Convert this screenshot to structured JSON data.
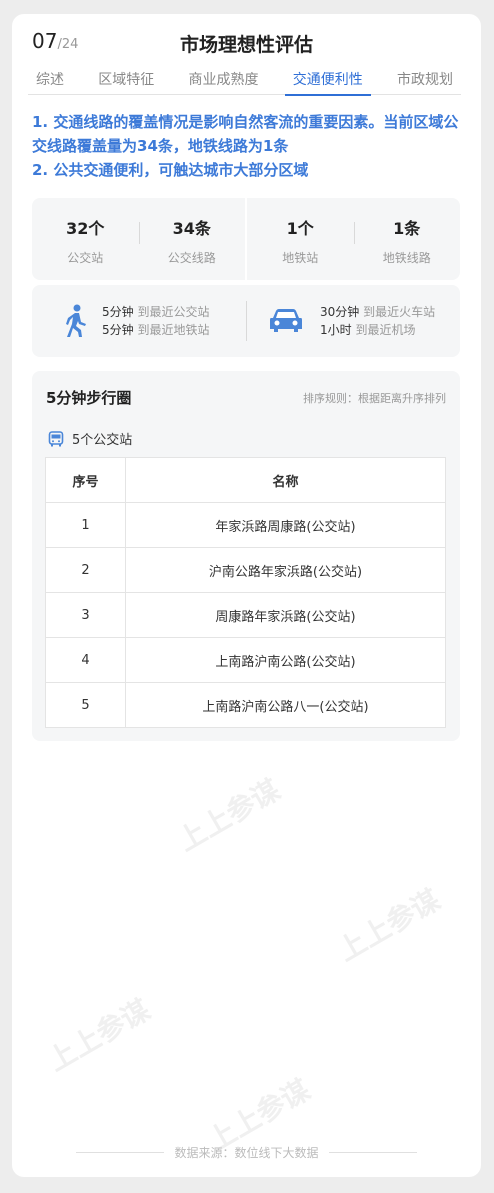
{
  "header": {
    "page_current": "07",
    "page_total": "/24",
    "title": "市场理想性评估"
  },
  "tabs": [
    {
      "label": "综述",
      "active": false
    },
    {
      "label": "区域特征",
      "active": false
    },
    {
      "label": "商业成熟度",
      "active": false
    },
    {
      "label": "交通便利性",
      "active": true
    },
    {
      "label": "市政规划",
      "active": false
    }
  ],
  "summary": {
    "line1": "1. 交通线路的覆盖情况是影响自然客流的重要因素。当前区域公交线路覆盖量为34条，地铁线路为1条",
    "line2": "2. 公共交通便利，可触达城市大部分区域"
  },
  "stats": [
    {
      "value": "32个",
      "label": "公交站"
    },
    {
      "value": "34条",
      "label": "公交线路"
    },
    {
      "value": "1个",
      "label": "地铁站"
    },
    {
      "value": "1条",
      "label": "地铁线路"
    }
  ],
  "distances": {
    "walk": [
      {
        "time": "5分钟",
        "desc": "到最近公交站"
      },
      {
        "time": "5分钟",
        "desc": "到最近地铁站"
      }
    ],
    "car": [
      {
        "time": "30分钟",
        "desc": "到最近火车站"
      },
      {
        "time": "1小时",
        "desc": "到最近机场"
      }
    ]
  },
  "walk_circle": {
    "title": "5分钟步行圈",
    "sort_rule": "排序规则：根据距离升序排列",
    "bus_count": "5个公交站",
    "columns": [
      "序号",
      "名称"
    ],
    "rows": [
      {
        "no": "1",
        "name": "年家浜路周康路(公交站)"
      },
      {
        "no": "2",
        "name": "沪南公路年家浜路(公交站)"
      },
      {
        "no": "3",
        "name": "周康路年家浜路(公交站)"
      },
      {
        "no": "4",
        "name": "上南路沪南公路(公交站)"
      },
      {
        "no": "5",
        "name": "上南路沪南公路八一(公交站)"
      }
    ]
  },
  "watermark": "上上参谋",
  "footer": "数据来源：数位线下大数据",
  "colors": {
    "accent": "#2f6fd6",
    "summary": "#3d7ad8",
    "icon": "#4a86d8"
  }
}
